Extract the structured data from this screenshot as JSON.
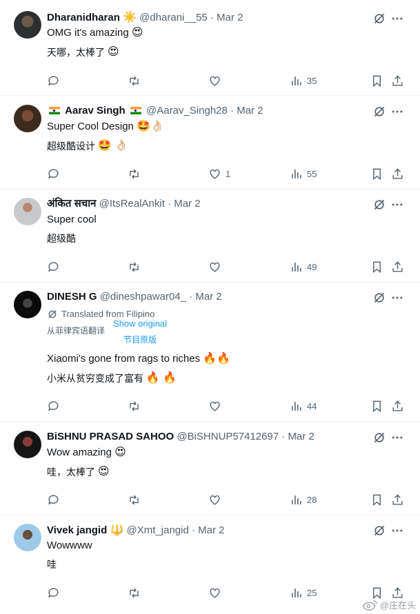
{
  "colors": {
    "accent": "#1d9bf0",
    "muted": "#536471",
    "text": "#0f1419",
    "divider": "#eff3f4"
  },
  "tweets": [
    {
      "name": "Dharanidharan",
      "name_badge": "☀️",
      "handle": "@dharani__55",
      "date": "· Mar 2",
      "text": "OMG it's amazing",
      "text_emoji": "😍",
      "zh": "天哪，太棒了",
      "zh_emoji": "😍",
      "reply_count": "",
      "like_count": "",
      "views": "35"
    },
    {
      "name": "Aarav Singh",
      "handle": "@Aarav_Singh28",
      "date": "· Mar 2",
      "text": "Super Cool Design",
      "text_emoji": "🤩👌🏻",
      "zh": "超级酷设计",
      "zh_emoji": "🤩 👌🏻",
      "like_count": "1",
      "views": "55"
    },
    {
      "name": "अंकित सचान",
      "handle": "@ItsRealAnkit",
      "date": "· Mar 2",
      "text": "Super cool",
      "zh": "超级酷",
      "like_count": "",
      "views": "49"
    },
    {
      "name": "DINESH G",
      "handle": "@dineshpawar04_",
      "date": "· Mar 2",
      "translated_label": "Translated from Filipino",
      "translated_zh": "从菲律宾语翻译",
      "show_original": "Show original",
      "show_original_zh": "节目原版",
      "text": "Xiaomi's gone from rags to riches",
      "text_emoji": "🔥🔥",
      "zh": "小米从贫穷变成了富有",
      "zh_emoji": "🔥 🔥",
      "like_count": "",
      "views": "44"
    },
    {
      "name": "BiSHNU PRASAD SAHOO",
      "handle": "@BiSHNUP57412697",
      "date": "· Mar 2",
      "text": "Wow amazing",
      "text_emoji": "😍",
      "zh": "哇，太棒了",
      "zh_emoji": "😍",
      "like_count": "",
      "views": "28"
    },
    {
      "name": "Vivek jangid",
      "name_badge": "🔱",
      "handle": "@Xmt_jangid",
      "date": "· Mar 2",
      "text": "Wowwww",
      "zh": "哇",
      "like_count": "",
      "views": "25"
    }
  ],
  "watermark": "@庄在头"
}
